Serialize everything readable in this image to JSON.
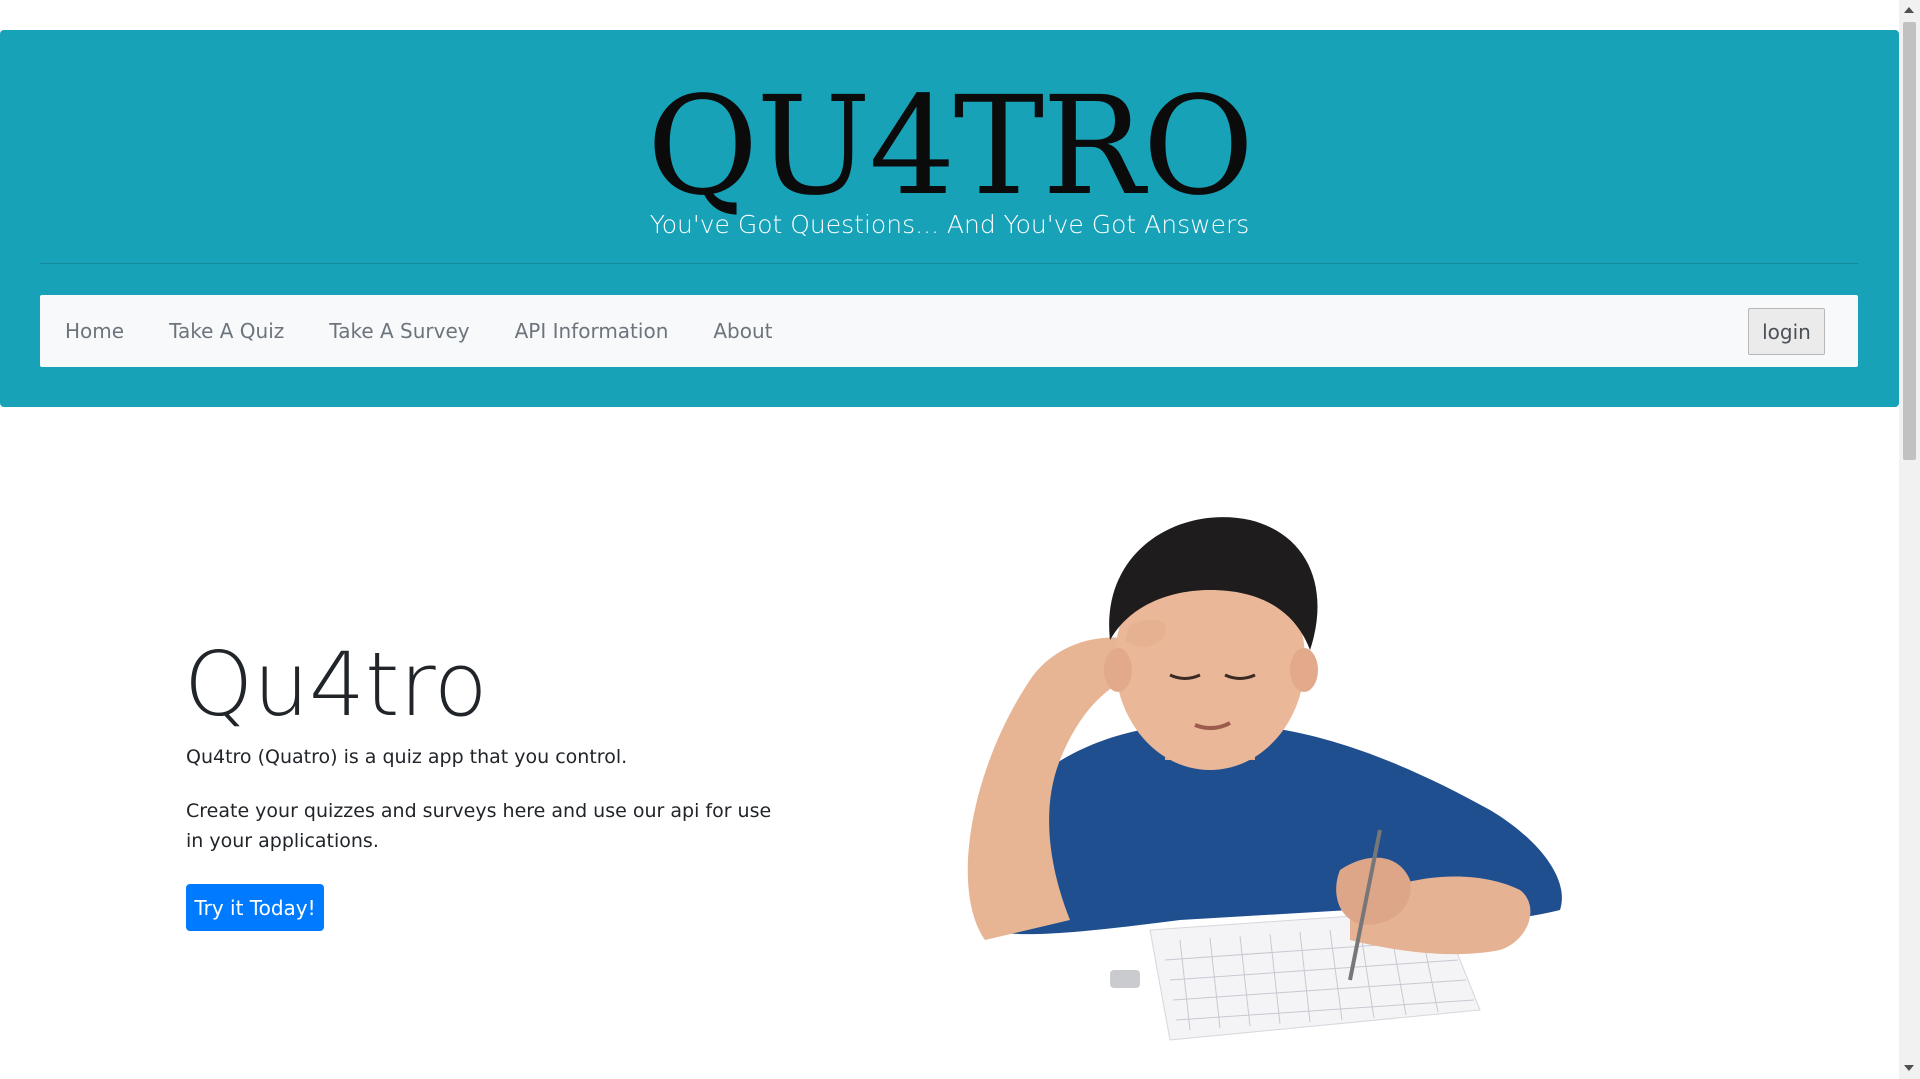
{
  "header": {
    "logo": "QU4TRO",
    "tagline": "You've Got Questions... And You've Got Answers"
  },
  "nav": {
    "items": [
      "Home",
      "Take A Quiz",
      "Take A Survey",
      "API Information",
      "About"
    ],
    "login_label": "login"
  },
  "hero": {
    "title": "Qu4tro",
    "text1": "Qu4tro (Quatro) is a quiz app that you control.",
    "text2": "Create your quizzes and surveys here and use our api for use in your applications.",
    "cta_label": "Try it Today!",
    "image_subject": "boy-doing-quiz-illustration"
  },
  "colors": {
    "header_bg": "#17a2b8",
    "nav_bg": "#f8f9fa",
    "cta_bg": "#007bff"
  }
}
